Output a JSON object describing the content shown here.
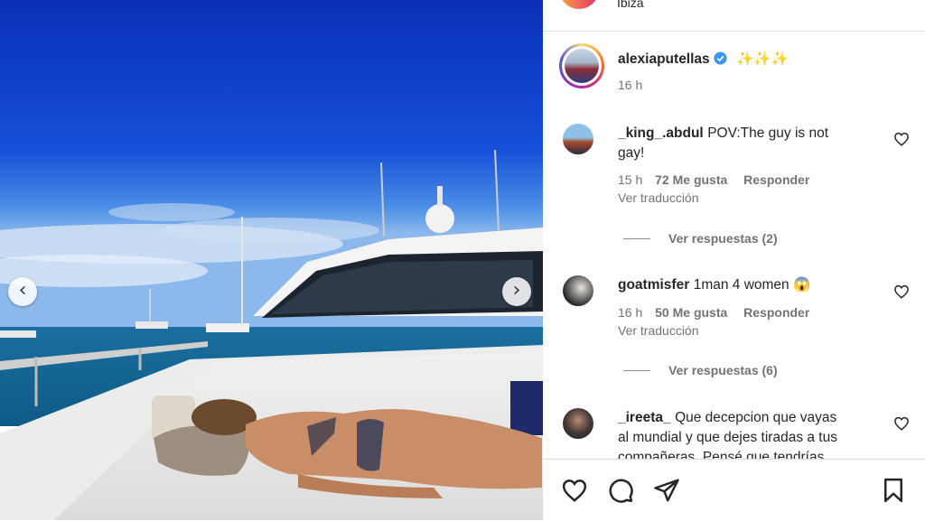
{
  "post": {
    "location": "Ibiza",
    "author": "alexiaputellas",
    "caption": "✨✨✨",
    "time": "16 h"
  },
  "comments": [
    {
      "user": "_king_.abdul",
      "text_line1": "POV:The guy is not",
      "text_line2": "gay!",
      "time": "15 h",
      "likes": "72 Me gusta",
      "reply": "Responder",
      "translate": "Ver traducción",
      "view_replies": "Ver respuestas (2)"
    },
    {
      "user": "goatmisfer",
      "text_line1": "1man 4 women 😱",
      "time": "16 h",
      "likes": "50 Me gusta",
      "reply": "Responder",
      "translate": "Ver traducción",
      "view_replies": "Ver respuestas (6)"
    },
    {
      "user": "_ireeta_",
      "text_line1": "Que decepcion que vayas",
      "text_line2": "al mundial y que dejes tiradas a tus",
      "text_line3": "compañeras. Pensé que tendrías"
    }
  ],
  "icons": {
    "like": "heart-icon",
    "comment": "comment-icon",
    "share": "share-icon",
    "save": "bookmark-icon",
    "prev": "chevron-left-icon",
    "next": "chevron-right-icon"
  },
  "colors": {
    "verified": "#3897f0",
    "text": "#262626",
    "secondary": "#737373"
  }
}
